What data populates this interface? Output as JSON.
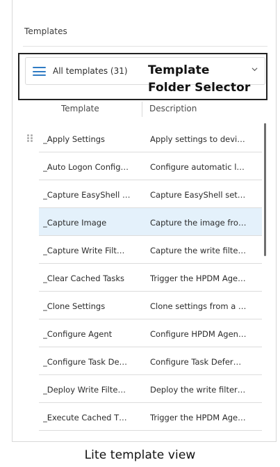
{
  "section": {
    "title": "Templates"
  },
  "folder_selector": {
    "label": "All templates (31)",
    "icon": "hamburger-menu-icon",
    "dropdown_icon": "chevron-down-icon",
    "accent_color": "#2f7bc4"
  },
  "annotation": {
    "label": "Template\nFolder Selector"
  },
  "table": {
    "columns": [
      "Template",
      "Description"
    ],
    "rows": [
      {
        "name": "_Apply Settings",
        "description": "Apply settings to devi…",
        "draggable": true
      },
      {
        "name": "_Auto Logon Config…",
        "description": "Configure automatic l…"
      },
      {
        "name": "_Capture EasyShell …",
        "description": "Capture EasyShell set…"
      },
      {
        "name": "_Capture Image",
        "description": "Capture the image fro…",
        "selected": true
      },
      {
        "name": "_Capture Write Filt…",
        "description": "Capture the write filte…"
      },
      {
        "name": "_Clear Cached Tasks",
        "description": "Trigger the HPDM Age…"
      },
      {
        "name": "_Clone Settings",
        "description": "Clone settings from a …"
      },
      {
        "name": "_Configure Agent",
        "description": "Configure HPDM Agen…"
      },
      {
        "name": "_Configure Task De…",
        "description": "Configure Task Defer…"
      },
      {
        "name": "_Deploy Write Filte…",
        "description": "Deploy the write filter…"
      },
      {
        "name": "_Execute Cached T…",
        "description": "Trigger the HPDM Age…"
      }
    ]
  },
  "caption": "Lite template view",
  "colors": {
    "selected_row": "#e4f1fb",
    "border": "#dcdcdc"
  }
}
